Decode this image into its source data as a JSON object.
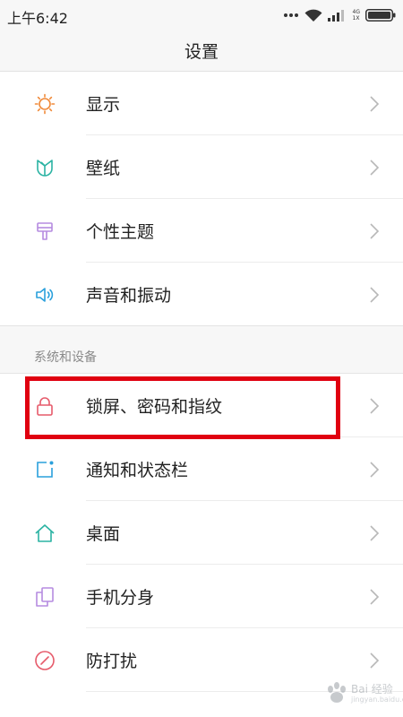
{
  "status_bar": {
    "time": "上午6:42",
    "network_top": "4G",
    "network_bottom": "1X"
  },
  "header": {
    "title": "设置"
  },
  "group_1": [
    {
      "label": "显示",
      "icon": "sun-icon",
      "color": "#f08a3a"
    },
    {
      "label": "壁纸",
      "icon": "wallpaper-tulip-icon",
      "color": "#2bb3a3"
    },
    {
      "label": "个性主题",
      "icon": "theme-brush-icon",
      "color": "#b58be0"
    },
    {
      "label": "声音和振动",
      "icon": "speaker-icon",
      "color": "#2aa0dc"
    }
  ],
  "section_system": {
    "header": "系统和设备"
  },
  "group_2": [
    {
      "label": "锁屏、密码和指纹",
      "icon": "lock-icon",
      "color": "#e65a6a"
    },
    {
      "label": "通知和状态栏",
      "icon": "notification-icon",
      "color": "#2aa0dc"
    },
    {
      "label": "桌面",
      "icon": "home-icon",
      "color": "#2bb3a3"
    },
    {
      "label": "手机分身",
      "icon": "second-space-icon",
      "color": "#b58be0"
    },
    {
      "label": "防打扰",
      "icon": "do-not-disturb-icon",
      "color": "#e65a6a"
    }
  ],
  "watermark": {
    "brand": "Bai 经验",
    "sub": "jingyan.baidu.com"
  },
  "colors": {
    "highlight": "#e00010",
    "chevron": "#b8b8b8"
  }
}
